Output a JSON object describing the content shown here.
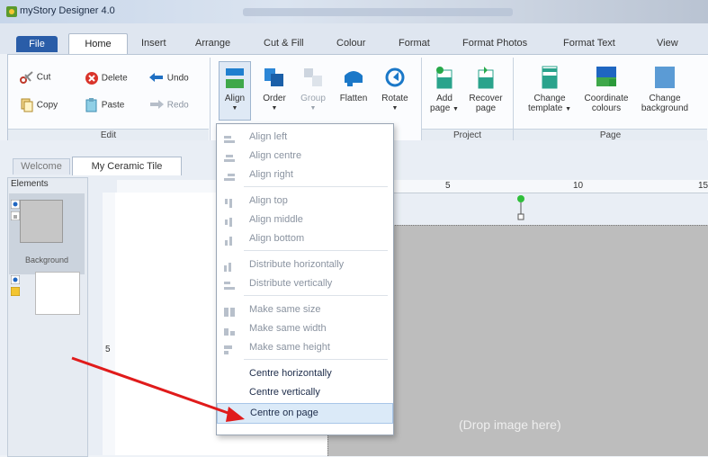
{
  "window": {
    "title": "myStory Designer 4.0"
  },
  "tabs": [
    "File",
    "Home",
    "Insert",
    "Arrange",
    "Cut & Fill",
    "Colour",
    "Format",
    "Format Photos",
    "Format Text",
    "View"
  ],
  "ribbon": {
    "edit": {
      "label": "Edit",
      "cut": "Cut",
      "copy": "Copy",
      "delete": "Delete",
      "paste": "Paste",
      "undo": "Undo",
      "redo": "Redo"
    },
    "arrange": {
      "align": "Align",
      "order": "Order",
      "group": "Group",
      "flatten": "Flatten",
      "rotate": "Rotate"
    },
    "project": {
      "label": "Project",
      "add_page_1": "Add",
      "add_page_2": "page",
      "recover_1": "Recover",
      "recover_2": "page"
    },
    "page": {
      "label": "Page",
      "change_template_1": "Change",
      "change_template_2": "template",
      "coord_1": "Coordinate",
      "coord_2": "colours",
      "bg_1": "Change",
      "bg_2": "background"
    }
  },
  "doc_tabs": {
    "welcome": "Welcome",
    "active": "My Ceramic Tile"
  },
  "elements_panel": {
    "title": "Elements",
    "background_label": "Background"
  },
  "ruler": {
    "h5": "5",
    "h10": "10",
    "h15": "15",
    "v5": "5"
  },
  "canvas": {
    "drop_text": "(Drop image here)"
  },
  "align_menu": {
    "items": [
      {
        "label": "Align left",
        "enabled": false
      },
      {
        "label": "Align centre",
        "enabled": false
      },
      {
        "label": "Align right",
        "enabled": false
      },
      {
        "label": "Align top",
        "enabled": false
      },
      {
        "label": "Align middle",
        "enabled": false
      },
      {
        "label": "Align bottom",
        "enabled": false
      },
      {
        "label": "Distribute horizontally",
        "enabled": false
      },
      {
        "label": "Distribute vertically",
        "enabled": false
      },
      {
        "label": "Make same size",
        "enabled": false
      },
      {
        "label": "Make same width",
        "enabled": false
      },
      {
        "label": "Make same height",
        "enabled": false
      },
      {
        "label": "Centre horizontally",
        "enabled": true
      },
      {
        "label": "Centre vertically",
        "enabled": true
      },
      {
        "label": "Centre on page",
        "enabled": true,
        "highlighted": true
      }
    ]
  },
  "colors": {
    "file_tab": "#2a5da8",
    "annotation_arrow": "#e01b1b",
    "highlight": "#dbeaf8"
  },
  "icons": [
    "scissors-icon",
    "copy-icon",
    "delete-icon",
    "paste-icon",
    "undo-icon",
    "redo-icon",
    "align-icon",
    "order-icon",
    "group-icon",
    "flatten-icon",
    "rotate-icon",
    "add-page-icon",
    "recover-page-icon",
    "change-template-icon",
    "coordinate-colours-icon",
    "change-background-icon",
    "eye-icon",
    "lock-icon"
  ]
}
